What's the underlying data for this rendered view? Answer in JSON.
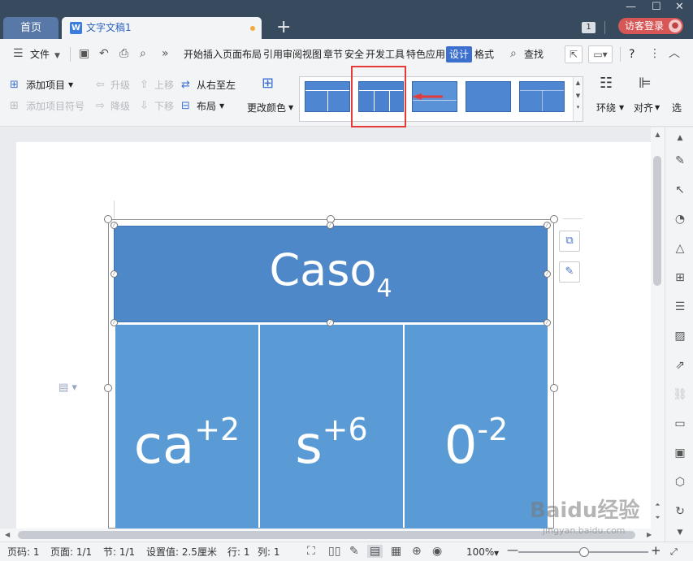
{
  "titlebar": {
    "home_tab": "首页",
    "doc_tab": "文字文稿1",
    "doc_icon": "W",
    "window_count": "1",
    "login_label": "访客登录"
  },
  "menubar": {
    "file_label": "文件",
    "overflow": "»",
    "tabs": [
      "开始",
      "插入",
      "页面布局",
      "引用",
      "审阅",
      "视图",
      "章节",
      "安全",
      "开发工具",
      "特色应用"
    ],
    "active_tab": "设计",
    "format_tab": "格式",
    "search_label": "查找",
    "help": "?"
  },
  "ribbon": {
    "add_item": "添加项目",
    "add_item_bullet": "添加项目符号",
    "promote": "升级",
    "demote": "降级",
    "move_up": "上移",
    "move_down": "下移",
    "right_to_left": "从右至左",
    "layout": "布局",
    "change_colors": "更改颜色",
    "wrap": "环绕",
    "align": "对齐",
    "select": "选"
  },
  "diagram": {
    "top_text": "Caso",
    "top_sub": "4",
    "boxes": [
      {
        "base": "ca",
        "sup": "+2"
      },
      {
        "base": "s",
        "sup": "+6"
      },
      {
        "base": "0",
        "sup": "-2"
      }
    ]
  },
  "statusbar": {
    "page_num": "页码: 1",
    "pages": "页面: 1/1",
    "section": "节: 1/1",
    "setting": "设置值: 2.5厘米",
    "row": "行: 1",
    "col": "列: 1",
    "zoom": "100%"
  },
  "watermark": {
    "text": "Baidu经验",
    "url": "jingyan.baidu.com"
  }
}
